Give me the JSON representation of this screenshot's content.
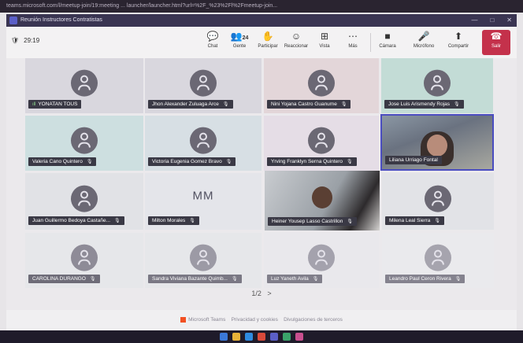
{
  "window": {
    "title": "Reunión Instructores Contratistas",
    "controls": [
      "—",
      "□",
      "✕"
    ]
  },
  "browser": {
    "url_text": "teams.microsoft.com/l/meetup-join/19:meeting ... launcher/launcher.html?url=%2F_%23%2Fl%2Fmeetup-join..."
  },
  "meeting": {
    "timer": "29:19"
  },
  "toolbar": {
    "chat": {
      "label": "Chat",
      "icon": "chat-icon"
    },
    "people": {
      "label": "Gente",
      "count": "24",
      "icon": "people-icon"
    },
    "raise": {
      "label": "Participar",
      "icon": "hand-icon"
    },
    "react": {
      "label": "Reaccionar",
      "icon": "smile-icon"
    },
    "view": {
      "label": "Vista",
      "icon": "grid-icon"
    },
    "more": {
      "label": "Más",
      "icon": "more-icon"
    },
    "camera": {
      "label": "Cámara",
      "icon": "camera-icon"
    },
    "mic": {
      "label": "Micrófono",
      "icon": "mic-icon"
    },
    "share": {
      "label": "Compartir",
      "icon": "share-icon"
    },
    "leave": {
      "label": "Salir",
      "icon": "phone-icon"
    }
  },
  "participants": [
    {
      "name": "YONATAN TOUS"
    },
    {
      "name": "Jhon Alexander Zuluaga Arce"
    },
    {
      "name": "Nini Yojana Castro Guanume"
    },
    {
      "name": "Jose Luis Arismendy Rojas"
    },
    {
      "name": "Valeria Cano Quintero"
    },
    {
      "name": "Victoria Eugenia Gomez Bravo"
    },
    {
      "name": "Yrving Franklyn Serna Quintero"
    },
    {
      "name": "Liliana Urriago Fontal"
    },
    {
      "name": "Juan Guillermo Bedoya Castañe..."
    },
    {
      "name": "Milton Morales",
      "initials": "MM"
    },
    {
      "name": "Heiner Yousep Lasso Castrillon"
    },
    {
      "name": "Milena Leal Sierra"
    },
    {
      "name": "CAROLINA DURANGO"
    },
    {
      "name": "Sandra Viviana Bazante Quimb..."
    },
    {
      "name": "Luz Yaneth Avila"
    },
    {
      "name": "Leandro Paul Ceron Rivera"
    }
  ],
  "pager": {
    "text": "1/2",
    "next": ">"
  },
  "footer": {
    "brand": "Microsoft Teams",
    "privacy": "Privacidad y cookies",
    "credits": "Divulgaciones de terceros"
  },
  "colors": {
    "accent": "#5b5fc7",
    "leave": "#c4314b",
    "nametag": "#3a3945"
  }
}
